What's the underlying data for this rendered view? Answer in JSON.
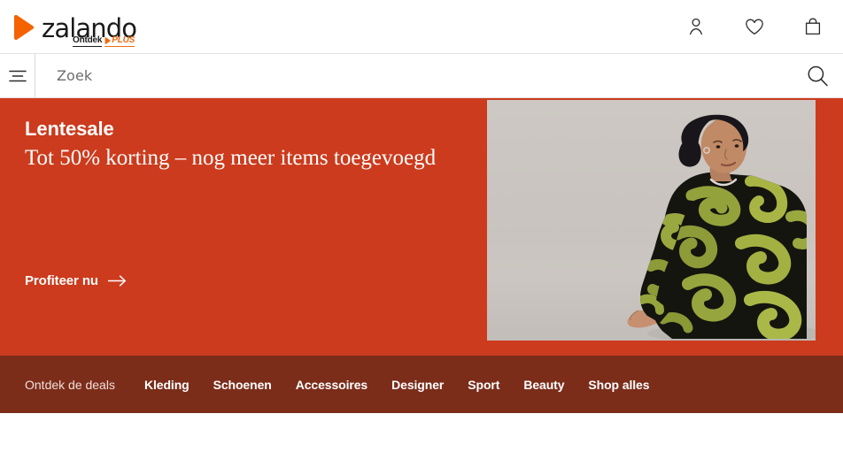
{
  "brand": {
    "name": "zalando",
    "logo_icon": "zalando-play-mark",
    "plus_prefix": "Ontdek",
    "plus_label": "PLUS",
    "mark_color": "#f56200",
    "plus_color": "#f06a11"
  },
  "header": {
    "icons": [
      {
        "name": "account-icon",
        "label": "Account"
      },
      {
        "name": "wishlist-heart-icon",
        "label": "Verlanglijstje"
      },
      {
        "name": "shopping-bag-icon",
        "label": "Winkelmandje"
      }
    ]
  },
  "search": {
    "menu_icon": "hamburger-menu-icon",
    "placeholder": "Zoek",
    "value": "",
    "submit_icon": "search-icon"
  },
  "hero": {
    "kicker": "Lentesale",
    "headline": "Tot 50% korting – nog meer items toegevoegd",
    "cta_label": "Profiteer nu",
    "cta_icon": "arrow-right-icon",
    "background_color": "#cc3b1d",
    "image_alt": "Model zittend in zwarte jurk met olijfgroene print"
  },
  "deals_nav": {
    "label": "Ontdek de deals",
    "background_color": "#7b2d1a",
    "links": [
      {
        "label": "Kleding"
      },
      {
        "label": "Schoenen"
      },
      {
        "label": "Accessoires"
      },
      {
        "label": "Designer"
      },
      {
        "label": "Sport"
      },
      {
        "label": "Beauty"
      },
      {
        "label": "Shop alles"
      }
    ]
  }
}
